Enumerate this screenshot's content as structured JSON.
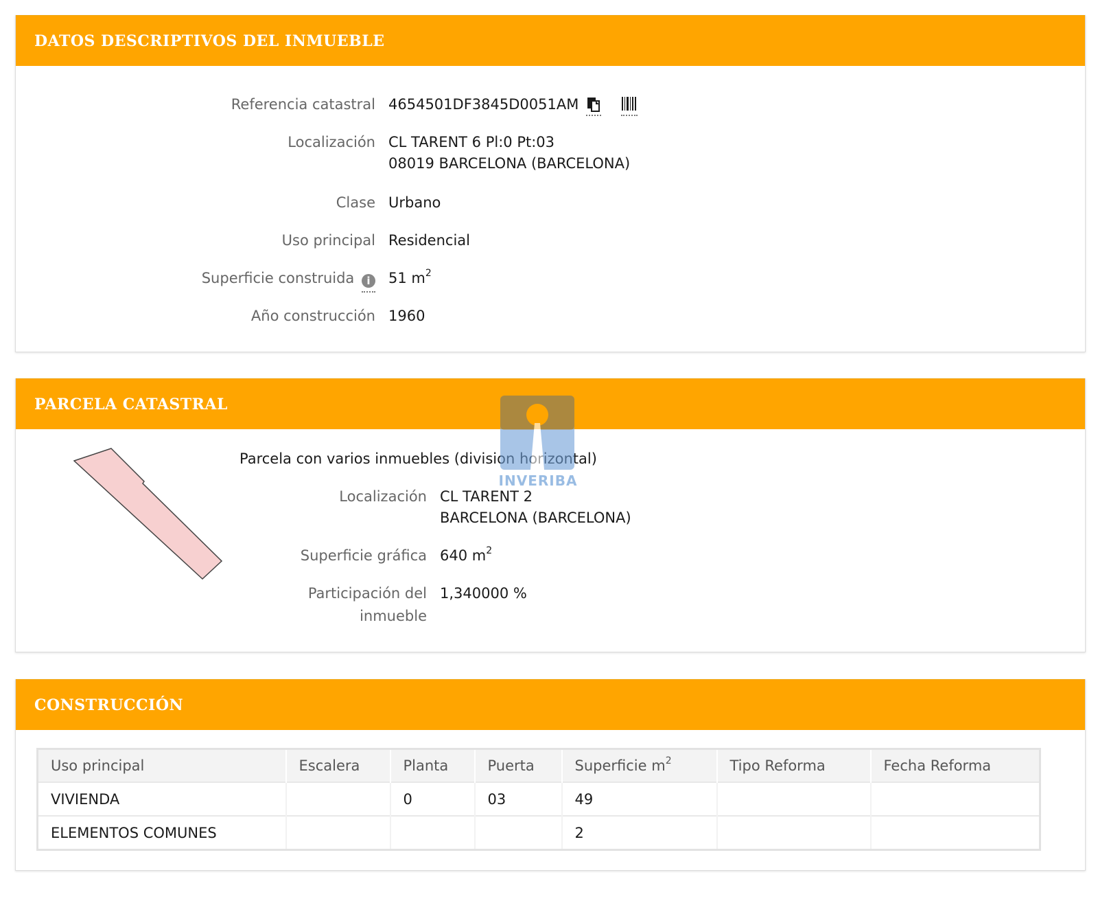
{
  "panels": {
    "datos": {
      "title": "DATOS DESCRIPTIVOS DEL INMUEBLE",
      "ref_label": "Referencia catastral",
      "ref_value": "4654501DF3845D0051AM",
      "loc_label": "Localización",
      "loc_line1": "CL TARENT 6 Pl:0 Pt:03",
      "loc_line2": "08019 BARCELONA (BARCELONA)",
      "clase_label": "Clase",
      "clase_value": "Urbano",
      "uso_label": "Uso principal",
      "uso_value": "Residencial",
      "sup_label": "Superficie construida",
      "sup_value": "51 m",
      "sup_exp": "2",
      "anio_label": "Año construcción",
      "anio_value": "1960"
    },
    "parcela": {
      "title": "PARCELA CATASTRAL",
      "desc": "Parcela con varios inmuebles (division horizontal)",
      "loc_label": "Localización",
      "loc_line1": "CL TARENT 2",
      "loc_line2": "BARCELONA (BARCELONA)",
      "sup_label": "Superficie gráfica",
      "sup_value": "640 m",
      "sup_exp": "2",
      "part_label1": "Participación del",
      "part_label2": "inmueble",
      "part_value": "1,340000 %"
    },
    "construccion": {
      "title": "CONSTRUCCIÓN",
      "headers": [
        "Uso principal",
        "Escalera",
        "Planta",
        "Puerta",
        "Superficie m",
        "Tipo Reforma",
        "Fecha Reforma"
      ],
      "sup_header_exp": "2",
      "rows": [
        [
          "VIVIENDA",
          "",
          "0",
          "03",
          "49",
          "",
          ""
        ],
        [
          "ELEMENTOS COMUNES",
          "",
          "",
          "",
          "2",
          "",
          ""
        ]
      ]
    }
  },
  "watermark": {
    "text": "INVERIBA"
  },
  "colors": {
    "header": "#ffa500",
    "parcel_fill": "#f7d0d0",
    "watermark": "#6fa0d8"
  }
}
